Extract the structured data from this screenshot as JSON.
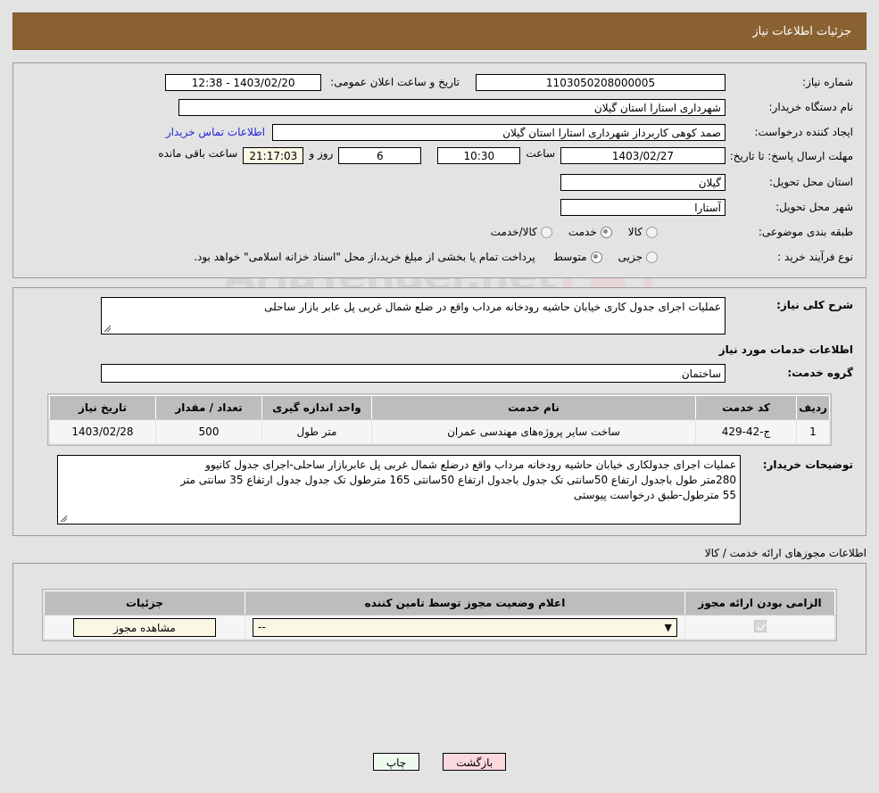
{
  "header": {
    "title": "جزئیات اطلاعات نیاز"
  },
  "watermark": {
    "text": "AriaTender.net"
  },
  "form": {
    "need_number_label": "شماره نیاز:",
    "need_number_value": "1103050208000005",
    "announce_label": "تاریخ و ساعت اعلان عمومی:",
    "announce_value": "1403/02/20 - 12:38",
    "buyer_org_label": "نام دستگاه خریدار:",
    "buyer_org_value": "شهرداری استارا استان گیلان",
    "requester_label": "ایجاد کننده درخواست:",
    "requester_value": "صمد کوهی کاربرداز شهرداری استارا استان گیلان",
    "contact_link": "اطلاعات تماس خریدار",
    "deadline_label": "مهلت ارسال پاسخ: تا تاریخ:",
    "deadline_date": "1403/02/27",
    "deadline_hour_label": "ساعت",
    "deadline_hour": "10:30",
    "days_value": "6",
    "days_label": "روز و",
    "countdown_value": "21:17:03",
    "countdown_label": "ساعت باقی مانده",
    "province_label": "استان محل تحویل:",
    "province_value": "گیلان",
    "city_label": "شهر محل تحویل:",
    "city_value": "آستارا",
    "category_label": "طبقه بندی موضوعی:",
    "category_options": [
      "کالا",
      "خدمت",
      "کالا/خدمت"
    ],
    "category_selected": "خدمت",
    "process_label": "نوع فرآیند خرید :",
    "process_options": [
      "جزیی",
      "متوسط"
    ],
    "process_selected": "متوسط",
    "process_note": "پرداخت تمام یا بخشی از مبلغ خرید،از محل \"اسناد خزانه اسلامی\" خواهد بود."
  },
  "description": {
    "label": "شرح کلی نیاز:",
    "value": "عملیات اجرای جدول کاری خیابان حاشیه رودخانه مرداب واقع در ضلع شمال غربی پل عابر بازار ساحلی"
  },
  "services_section": {
    "title": "اطلاعات خدمات مورد نیاز",
    "group_label": "گروه خدمت:",
    "group_value": "ساختمان",
    "columns": [
      "ردیف",
      "کد خدمت",
      "نام خدمت",
      "واحد اندازه گیری",
      "تعداد / مقدار",
      "تاریخ نیاز"
    ],
    "rows": [
      {
        "radif": "1",
        "code": "ج-42-429",
        "name": "ساخت سایر پروژه‌های مهندسی عمران",
        "unit": "متر طول",
        "qty": "500",
        "date": "1403/02/28"
      }
    ]
  },
  "buyer_notes": {
    "label": "توضیحات خریدار:",
    "lines": [
      "عملیات اجرای جدولکاری خیابان حاشیه رودخانه مرداب واقع درضلع شمال غربی پل عابربازار ساحلی-اجرای جدول کانیوو",
      "280متر طول باجدول ارتفاع 50سانتی تک جدول باجدول ارتفاع 50سانتی 165 مترطول تک جدول جدول ارتفاع 35 سانتی متر",
      "55 مترطول-طبق درخواست پیوستی"
    ]
  },
  "licenses": {
    "section_title": "اطلاعات مجوزهای ارائه خدمت / کالا",
    "columns": [
      "الزامی بودن ارائه مجوز",
      "اعلام وضعیت مجوز توسط تامین کننده",
      "جزئیات"
    ],
    "rows": [
      {
        "required": true,
        "status_value": "--",
        "details_button": "مشاهده مجوز"
      }
    ]
  },
  "footer": {
    "print_label": "چاپ",
    "back_label": "بازگشت"
  }
}
